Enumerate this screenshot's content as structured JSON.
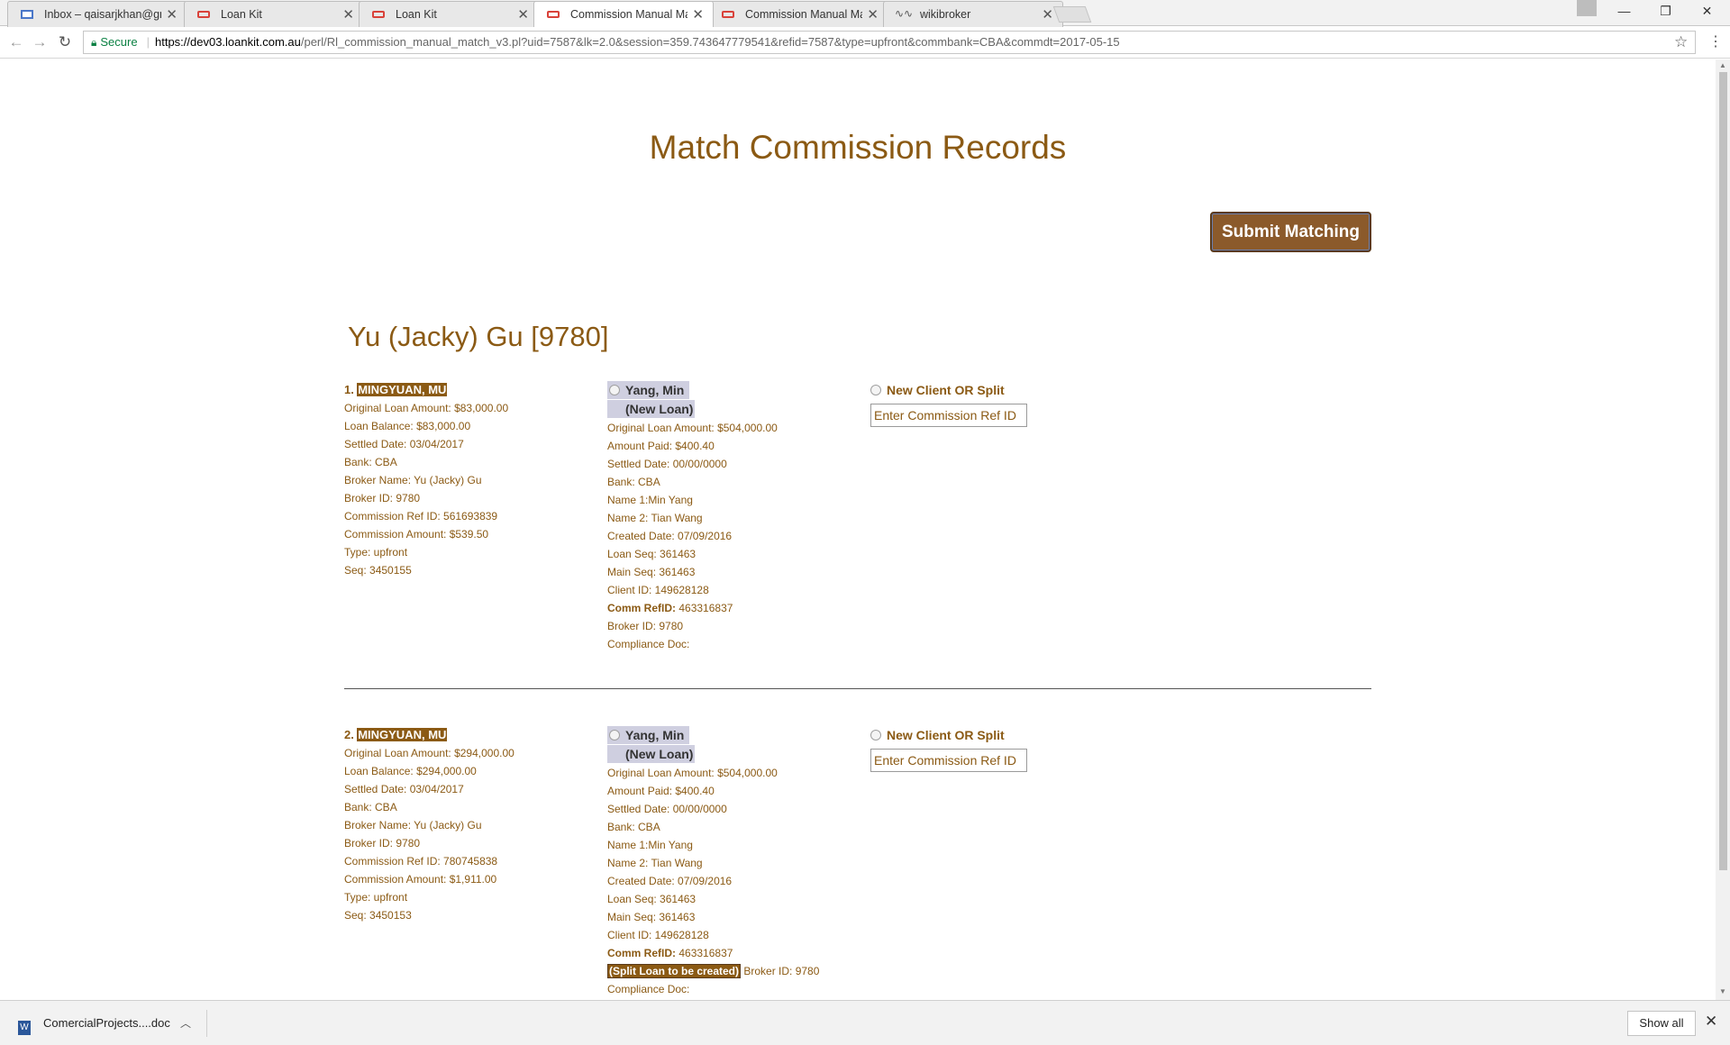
{
  "tabs": [
    {
      "title": "Inbox – qaisarjkhan@gm",
      "icon": "gmail-icon"
    },
    {
      "title": "Loan Kit",
      "icon": "loankit-icon"
    },
    {
      "title": "Loan Kit",
      "icon": "loankit-icon"
    },
    {
      "title": "Commission Manual Mat",
      "icon": "loankit-icon"
    },
    {
      "title": "Commission Manual Mat",
      "icon": "loankit-icon"
    },
    {
      "title": "wikibroker",
      "icon": "wiki-icon"
    }
  ],
  "address_bar": {
    "secure_label": "Secure",
    "url_host": "https://dev03.loankit.com.au",
    "url_path": "/perl/Rl_commission_manual_match_v3.pl?uid=7587&lk=2.0&session=359.743647779541&refid=7587&type=upfront&commbank=CBA&commdt=2017-05-15"
  },
  "page": {
    "title": "Match Commission Records",
    "submit_label": "Submit Matching",
    "broker_heading": "Yu (Jacky) Gu [9780]"
  },
  "records": [
    {
      "number": "1.",
      "name": "MINGYUAN, MU",
      "lines": [
        "Original Loan Amount: $83,000.00",
        "Loan Balance: $83,000.00",
        "Settled Date: 03/04/2017",
        "Bank: CBA",
        "Broker Name: Yu (Jacky) Gu",
        "Broker ID: 9780",
        "Commission Ref ID: 561693839",
        "Commission Amount: $539.50",
        "Type: upfront",
        "Seq: 3450155"
      ],
      "match": {
        "name": "Yang, Min",
        "tag": "(New Loan)",
        "lines": [
          "Original Loan Amount: $504,000.00",
          "Amount Paid: $400.40",
          "Settled Date: 00/00/0000",
          "Bank: CBA",
          "Name 1:Min Yang",
          "Name 2: Tian Wang",
          "Created Date: 07/09/2016",
          "Loan Seq: 361463",
          "Main Seq: 361463",
          "Client ID: 149628128"
        ],
        "comm_ref_label": "Comm RefID:",
        "comm_ref_value": " 463316837",
        "split_badge": "",
        "broker_id": "Broker ID: 9780",
        "compliance": "Compliance Doc:"
      },
      "new_client_label": "New Client OR Split",
      "ref_placeholder": "Enter Commission Ref ID"
    },
    {
      "number": "2.",
      "name": "MINGYUAN, MU",
      "lines": [
        "Original Loan Amount: $294,000.00",
        "Loan Balance: $294,000.00",
        "Settled Date: 03/04/2017",
        "Bank: CBA",
        "Broker Name: Yu (Jacky) Gu",
        "Broker ID: 9780",
        "Commission Ref ID: 780745838",
        "Commission Amount: $1,911.00",
        "Type: upfront",
        "Seq: 3450153"
      ],
      "match": {
        "name": "Yang, Min",
        "tag": "(New Loan)",
        "lines": [
          "Original Loan Amount: $504,000.00",
          "Amount Paid: $400.40",
          "Settled Date: 00/00/0000",
          "Bank: CBA",
          "Name 1:Min Yang",
          "Name 2: Tian Wang",
          "Created Date: 07/09/2016",
          "Loan Seq: 361463",
          "Main Seq: 361463",
          "Client ID: 149628128"
        ],
        "comm_ref_label": "Comm RefID:",
        "comm_ref_value": " 463316837",
        "split_badge": "(Split Loan to be created)",
        "broker_id": "Broker ID: 9780",
        "compliance": "Compliance Doc:"
      },
      "new_client_label": "New Client OR Split",
      "ref_placeholder": "Enter Commission Ref ID"
    }
  ],
  "download_bar": {
    "file_name": "ComercialProjects....doc",
    "show_all_label": "Show all"
  },
  "colors": {
    "brand_brown": "#8b5a14",
    "button_bg": "#8b5a2b",
    "option_bg": "#cfcfe0"
  }
}
